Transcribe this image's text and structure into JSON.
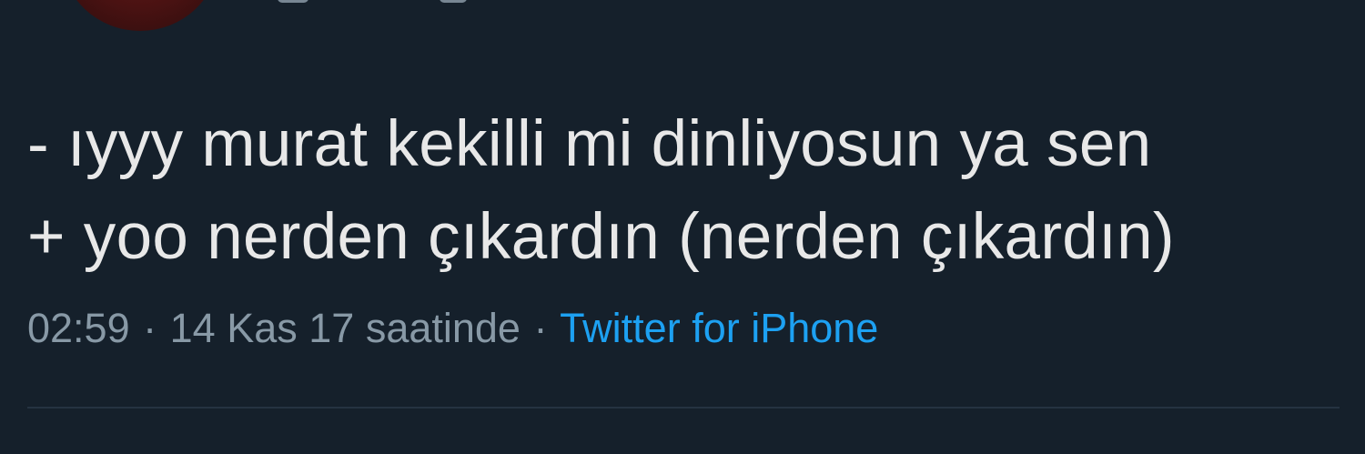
{
  "tweet": {
    "lines": [
      "- ıyyy murat kekilli mi dinliyosun ya sen",
      "+ yoo nerden çıkardın (nerden çıkardın)"
    ],
    "time": "02:59",
    "separator": "·",
    "date": "14 Kas 17 saatinde",
    "source": "Twitter for iPhone"
  },
  "colors": {
    "background": "#15202b",
    "text": "#e8e8e8",
    "secondary_text": "#8899a6",
    "link": "#1da1f2",
    "divider": "#253341"
  }
}
